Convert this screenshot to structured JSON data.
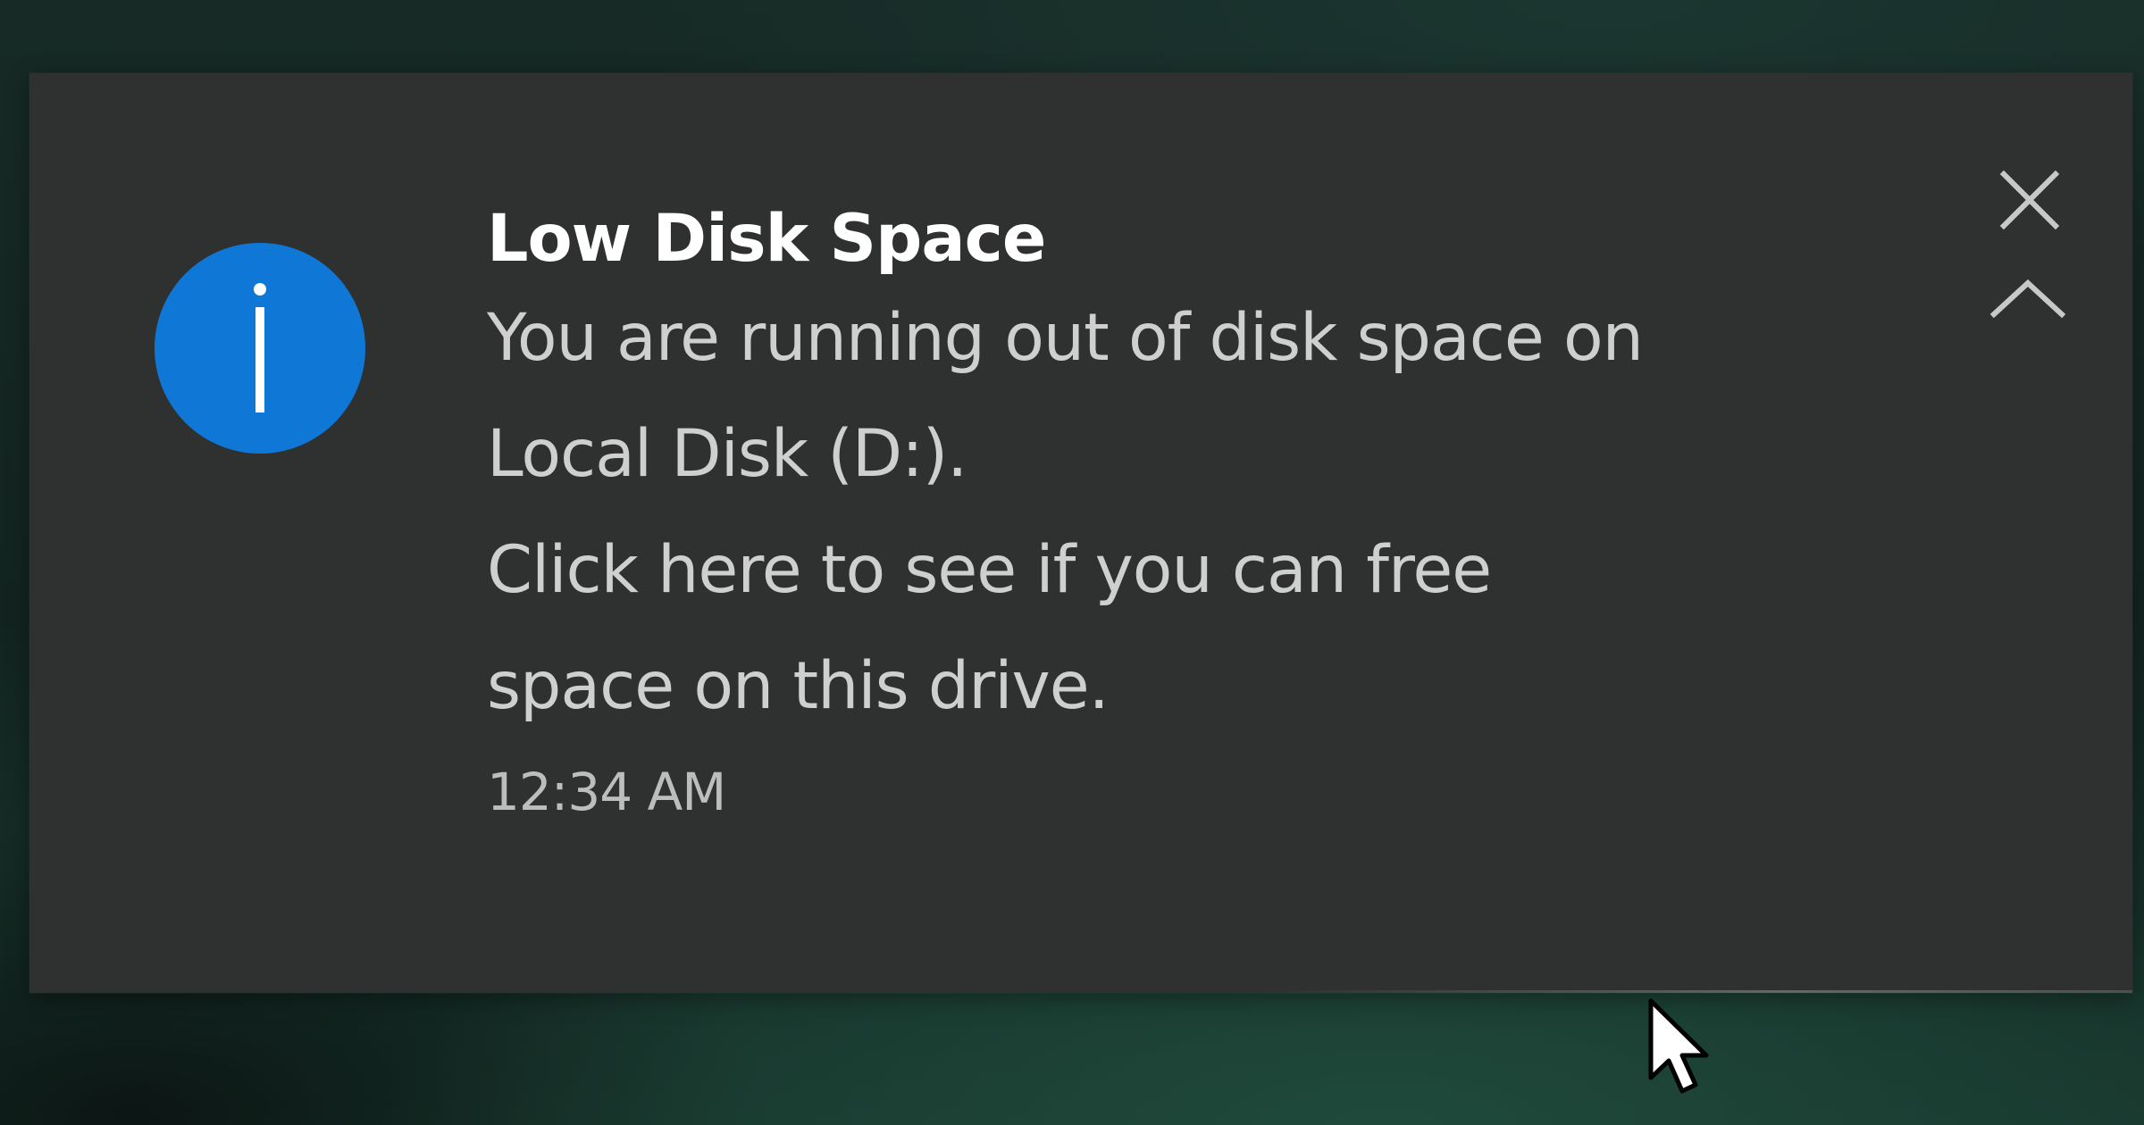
{
  "notification": {
    "title": "Low Disk Space",
    "message_lines": [
      "You are running out of disk space on",
      "Local Disk (D:).",
      "Click here to see if you can free",
      "space on this drive."
    ],
    "time": "12:34 AM",
    "icon": "info-icon",
    "icon_color": "#0F78D7",
    "close_icon": "close-icon",
    "collapse_icon": "chevron-up-icon"
  },
  "colors": {
    "toast_background": "#2F3131",
    "title_text": "#FFFFFF",
    "body_text": "#CFCFCF"
  }
}
